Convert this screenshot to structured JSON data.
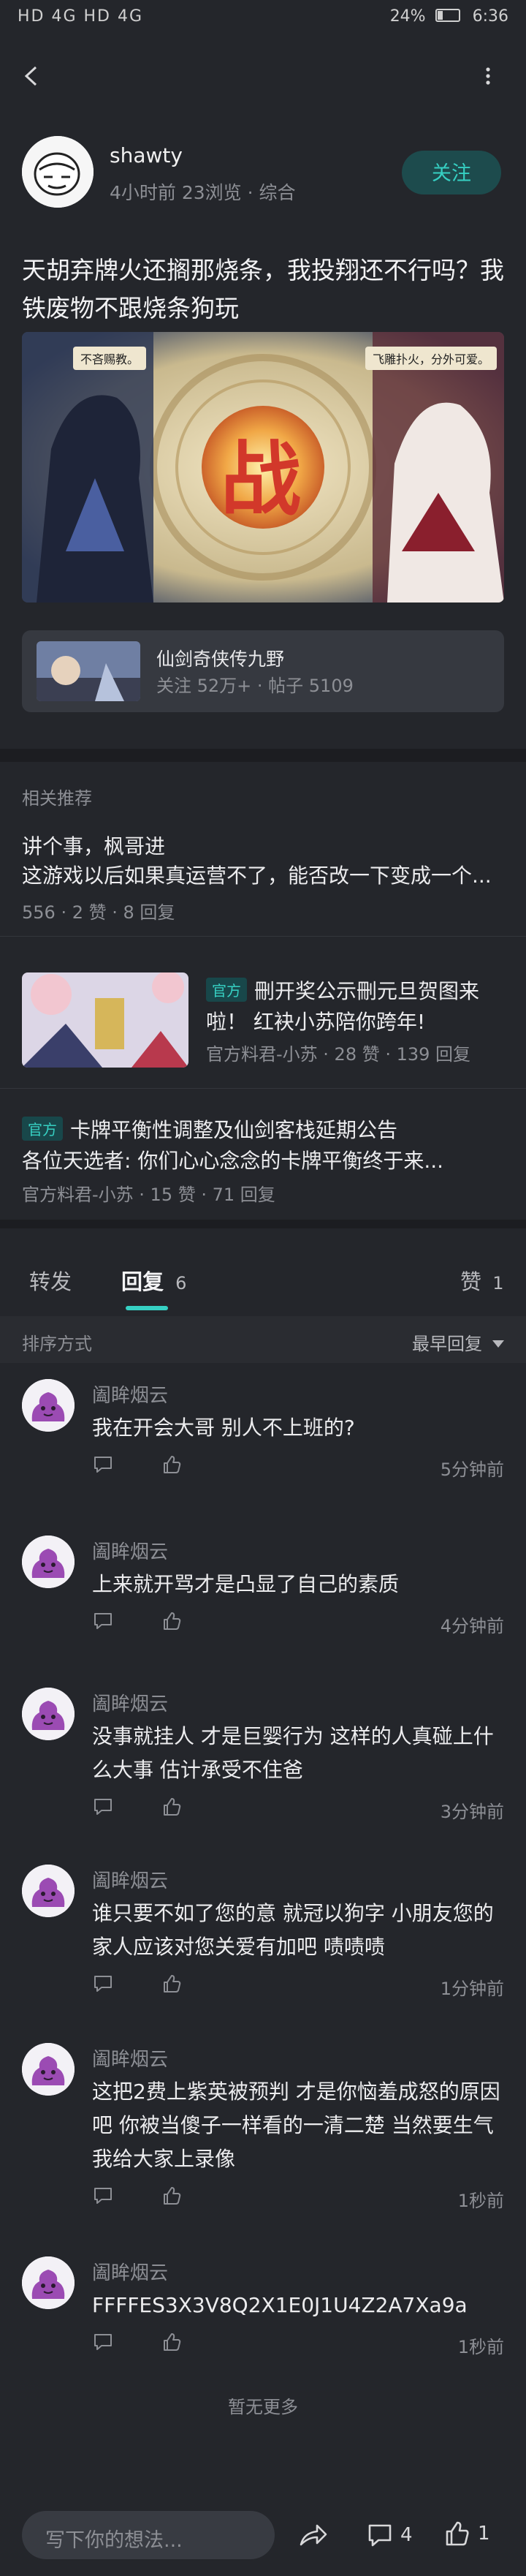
{
  "status_bar": {
    "left": "HD 4G HD 4G",
    "battery": "24%",
    "time": "6:36"
  },
  "post": {
    "author": "shawty",
    "meta": "4小时前  23浏览  ·  综合",
    "follow_label": "关注",
    "title": "天胡弃牌火还搁那烧条，我投翔还不行吗？我铁废物不跟烧条狗玩",
    "banner": {
      "speech_left": "不吝赐教。",
      "speech_right": "飞雕扑火，分外可爱。",
      "center_char": "战"
    }
  },
  "game": {
    "name": "仙剑奇侠传九野",
    "stats": "关注 52万+  ·  帖子 5109"
  },
  "related": {
    "section_title": "相关推荐",
    "items": [
      {
        "title_line1": "讲个事，枫哥进",
        "title_line2": "这游戏以后如果真运营不了，能否改一下变成一个...",
        "meta": "556  ·  2 赞  ·  8 回复"
      },
      {
        "badge": "官方",
        "title_line1": "刪开奖公示刪元旦贺图来",
        "title_line2": "啦！ 红袂小苏陪你跨年!",
        "meta": "官方料君-小苏  ·  28 赞  ·  139 回复"
      },
      {
        "badge": "官方",
        "title_line1": "卡牌平衡性调整及仙剑客栈延期公告",
        "title_line2": "各位天选者:          你们心心念念的卡牌平衡终于来...",
        "meta": "官方料君-小苏  ·  15 赞  ·  71 回复"
      }
    ]
  },
  "tabs": {
    "forward": "转发",
    "reply": "回复",
    "reply_count": "6",
    "like": "赞",
    "like_count": "1"
  },
  "sort": {
    "label": "排序方式",
    "value": "最早回复"
  },
  "comments": [
    {
      "name": "阖眸烟云",
      "lines": [
        "我在开会大哥 别人不上班的?"
      ],
      "time": "5分钟前"
    },
    {
      "name": "阖眸烟云",
      "lines": [
        "上来就开骂才是凸显了自己的素质"
      ],
      "time": "4分钟前"
    },
    {
      "name": "阖眸烟云",
      "lines": [
        "没事就挂人 才是巨婴行为 这样的人真碰上什",
        "么大事 估计承受不住爸"
      ],
      "time": "3分钟前"
    },
    {
      "name": "阖眸烟云",
      "lines": [
        "谁只要不如了您的意 就冠以狗字 小朋友您的",
        "家人应该对您关爱有加吧 啧啧啧"
      ],
      "time": "1分钟前"
    },
    {
      "name": "阖眸烟云",
      "lines": [
        "这把2费上紫英被预判 才是你恼羞成怒的原因",
        "吧 你被当傻子一样看的一清二楚 当然要生气",
        "我给大家上录像"
      ],
      "time": "1秒前"
    },
    {
      "name": "阖眸烟云",
      "lines": [
        "FFFFES3X3V8Q2X1E0J1U4Z2A7Xa9a"
      ],
      "time": "1秒前"
    }
  ],
  "no_more": "暂无更多",
  "bottom_bar": {
    "placeholder": "写下你的想法...",
    "comment_count": "4",
    "like_count": "1"
  },
  "colors": {
    "background": "#24262b",
    "accent": "#36d0c3",
    "muted_text": "#8d8f95"
  }
}
